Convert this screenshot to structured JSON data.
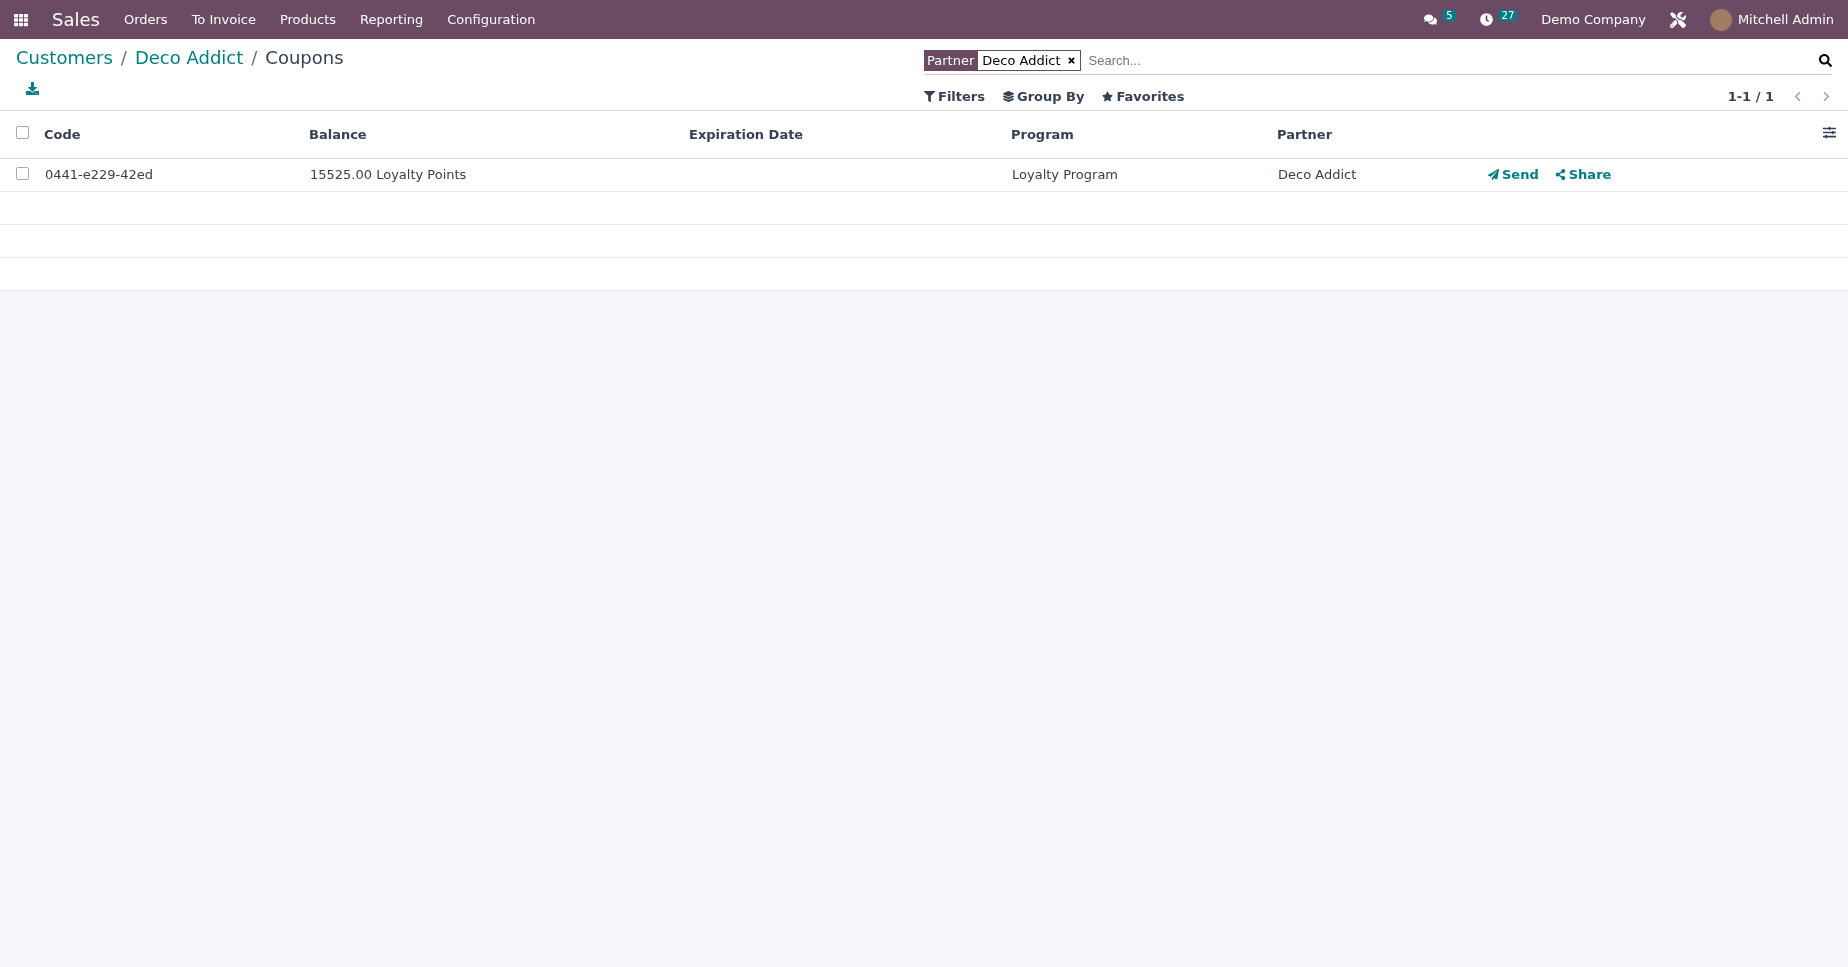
{
  "navbar": {
    "app": "Sales",
    "menu": [
      "Orders",
      "To Invoice",
      "Products",
      "Reporting",
      "Configuration"
    ],
    "messages_count": "5",
    "activities_count": "27",
    "company": "Demo Company",
    "user": "Mitchell Admin"
  },
  "breadcrumbs": [
    "Customers",
    "Deco Addict",
    "Coupons"
  ],
  "breadcrumb_separator": "/",
  "search": {
    "facet_label": "Partner",
    "facet_value": "Deco Addict",
    "placeholder": "Search..."
  },
  "filters": [
    "Filters",
    "Group By",
    "Favorites"
  ],
  "pager": "1-1 / 1",
  "table": {
    "select_all_checked": false,
    "columns": [
      "Code",
      "Balance",
      "Expiration Date",
      "Program",
      "Partner"
    ],
    "rows": [
      {
        "checked": false,
        "cells": [
          "0441-e229-42ed",
          "15525.00 Loyalty Points",
          "",
          "Loyalty Program",
          "Deco Addict"
        ],
        "actions": [
          "Send",
          "Share"
        ]
      }
    ]
  }
}
